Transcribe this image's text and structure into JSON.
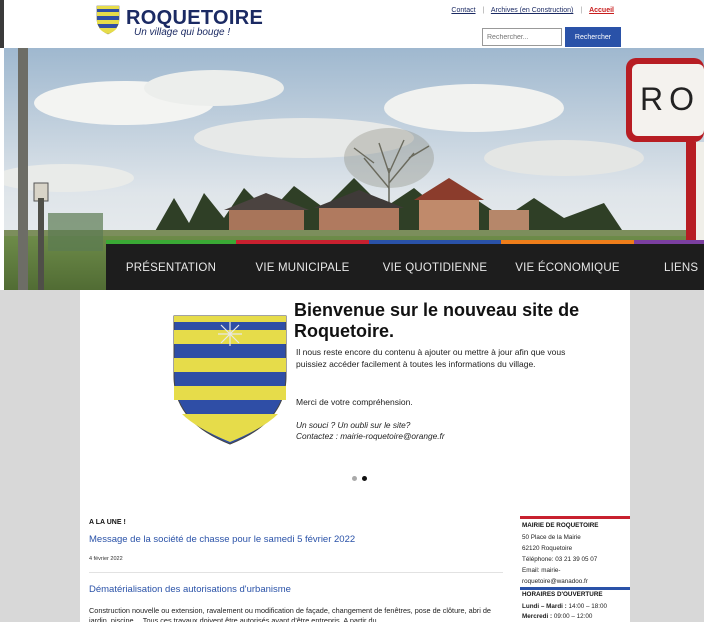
{
  "site": {
    "name": "ROQUETOIRE",
    "tagline": "Un village qui bouge !"
  },
  "top_links": {
    "contact": "Contact",
    "archives": "Archives (en Construction)",
    "accueil": "Accueil",
    "separator": "|"
  },
  "search": {
    "placeholder": "Rechercher...",
    "button_label": "Rechercher"
  },
  "hero": {
    "sign_text": "RO"
  },
  "nav": {
    "items": [
      {
        "label": "PRÉSENTATION",
        "color": "#3aa935"
      },
      {
        "label": "VIE MUNICIPALE",
        "color": "#c8202f"
      },
      {
        "label": "VIE QUOTIDIENNE",
        "color": "#2a52a8"
      },
      {
        "label": "VIE ÉCONOMIQUE",
        "color": "#ee7d1a"
      },
      {
        "label": "LIENS U",
        "color": "#7b3fa0"
      }
    ]
  },
  "slide": {
    "heading": "Bienvenue sur le nouveau site de Roquetoire.",
    "text": "Il nous reste encore du contenu à ajouter ou mettre à jour afin que vous puissiez accéder facilement à toutes les informations du village.",
    "thanks": "Merci de votre compréhension.",
    "contact_line1": "Un souci ? Un oubli sur le site?",
    "contact_line2": "Contactez : mairie-roquetoire@orange.fr",
    "active_dot": 1
  },
  "news": {
    "section_label": "A LA UNE !",
    "items": [
      {
        "title": "Message de la société de chasse pour le samedi 5 février 2022",
        "date": "4 février 2022"
      },
      {
        "title": "Dématérialisation des autorisations d'urbanisme",
        "excerpt": "Construction nouvelle ou extension, ravalement ou modification de façade, changement de fenêtres, pose de clôture, abri de jardin, piscine… Tous ces travaux doivent être autorisés avant d'être entrepris. A partir du"
      }
    ]
  },
  "sidebar": {
    "mairie_title": "MAIRIE DE ROQUETOIRE",
    "address1": "50 Place de la Mairie",
    "address2": "62120 Roquetoire",
    "phone": "Téléphone: 03 21 39 05 07",
    "email_label": "Email: mairie-",
    "email_rest": "roquetoire@wanadoo.fr",
    "hours_title": "HORAIRES D'OUVERTURE",
    "hours": [
      {
        "day": "Lundi – Mardi :",
        "time": "14:00 – 18:00"
      },
      {
        "day": "Mercredi :",
        "time": "09:00 – 12:00"
      }
    ],
    "accent_color": "#c8202f",
    "accent_color2": "#2a52a8"
  },
  "colors": {
    "brand_blue": "#1b2a63",
    "link_blue": "#2a52a8",
    "nav_bg": "#1d1d1d",
    "accueil_red": "#c81d1d",
    "shield_blue": "#2f4ea6",
    "shield_yellow": "#e6dc4a"
  }
}
